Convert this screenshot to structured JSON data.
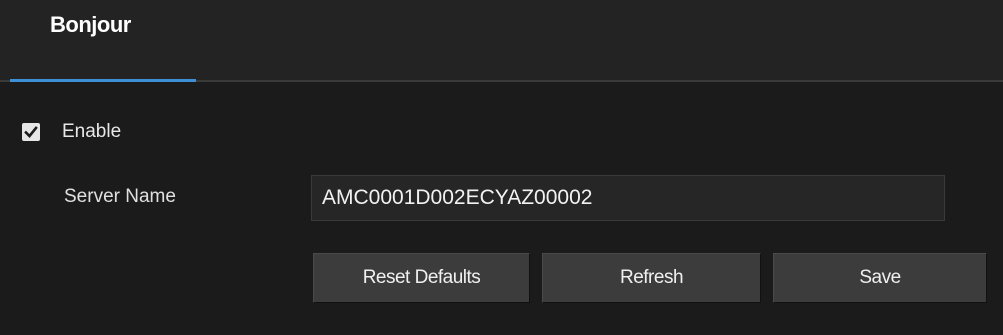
{
  "tabs": [
    {
      "label": "Bonjour",
      "active": true
    }
  ],
  "colors": {
    "accent": "#3d8fd6",
    "background": "#1b1b1b",
    "button": "#3c3c3c"
  },
  "form": {
    "enable": {
      "label": "Enable",
      "checked": true
    },
    "server_name": {
      "label": "Server Name",
      "value": "AMC0001D002ECYAZ00002"
    }
  },
  "buttons": {
    "reset_label": "Reset Defaults",
    "refresh_label": "Refresh",
    "save_label": "Save"
  }
}
